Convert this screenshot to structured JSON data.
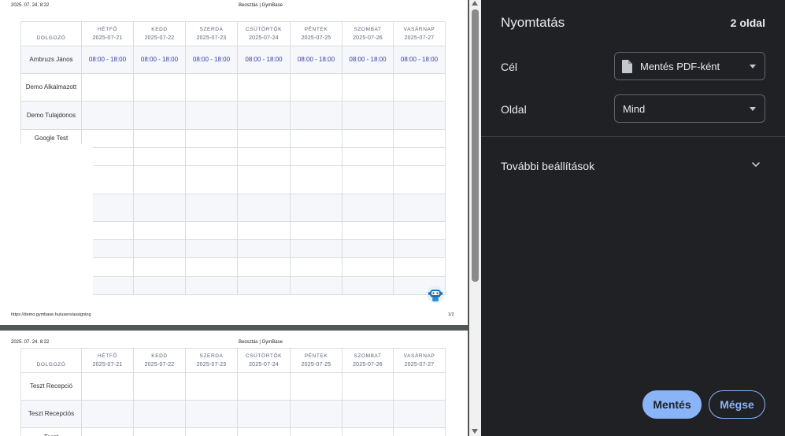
{
  "preview": {
    "page1": {
      "header_date": "2025. 07. 24. 8:22",
      "header_title": "Beosztás | GymBase",
      "footer_url": "https://demo.gymbase.hu/users/assigning",
      "footer_page": "1/2"
    },
    "page2": {
      "header_date": "2025. 07. 24. 8:22",
      "header_title": "Beosztás | GymBase"
    },
    "table": {
      "employee_header": "DOLGOZÓ",
      "days": [
        {
          "name": "HÉTFŐ",
          "date": "2025-07-21"
        },
        {
          "name": "KEDD",
          "date": "2025-07-22"
        },
        {
          "name": "SZERDA",
          "date": "2025-07-23"
        },
        {
          "name": "CSÜTÖRTÖK",
          "date": "2025-07-24"
        },
        {
          "name": "PÉNTEK",
          "date": "2025-07-25"
        },
        {
          "name": "SZOMBAT",
          "date": "2025-07-26"
        },
        {
          "name": "VASÁRNAP",
          "date": "2025-07-27"
        }
      ],
      "page1_rows": [
        {
          "name": "Ambruzs János",
          "shift": "08:00 - 18:00"
        },
        {
          "name": "Demo Alkalmazott",
          "shift": ""
        },
        {
          "name": "Demo Tulajdonos",
          "shift": ""
        },
        {
          "name": "Google Test",
          "shift": ""
        }
      ],
      "page2_rows": [
        {
          "name": "Teszt Recepció",
          "shift": ""
        },
        {
          "name": "Teszt Recepciós",
          "shift": ""
        },
        {
          "name": "Teszt",
          "shift": ""
        }
      ]
    },
    "bot_icon": "robot-icon"
  },
  "panel": {
    "title": "Nyomtatás",
    "page_count": "2 oldal",
    "destination_label": "Cél",
    "destination_value": "Mentés PDF-ként",
    "destination_icon": "file-icon",
    "pages_label": "Oldal",
    "pages_value": "Mind",
    "more_settings": "További beállítások",
    "save_button": "Mentés",
    "cancel_button": "Mégse"
  },
  "colors": {
    "panel_bg": "#202124",
    "accent": "#8ab4f8",
    "shift_text": "#3a3fa8"
  }
}
